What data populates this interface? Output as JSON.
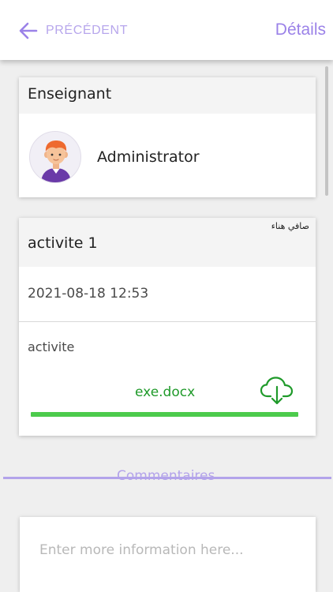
{
  "header": {
    "back_label": "PRÉCÉDENT",
    "title": "Détails"
  },
  "teacher": {
    "heading": "Enseignant",
    "name": "Administrator"
  },
  "activity": {
    "author": "صافي هناء",
    "title": "activite 1",
    "date": "2021-08-18 12:53",
    "description": "activite",
    "file_name": "exe.docx",
    "upload_progress": 1.0
  },
  "comments": {
    "label": "Commentaires",
    "placeholder": "Enter more information here..."
  },
  "colors": {
    "accent": "#9b82e8",
    "accent_light": "#b3a3ea",
    "file_green": "#1f9a2a",
    "progress_green": "#4ccb4c"
  },
  "icons": {
    "back": "arrow-left-icon",
    "avatar": "user-avatar-icon",
    "download": "cloud-download-icon"
  }
}
